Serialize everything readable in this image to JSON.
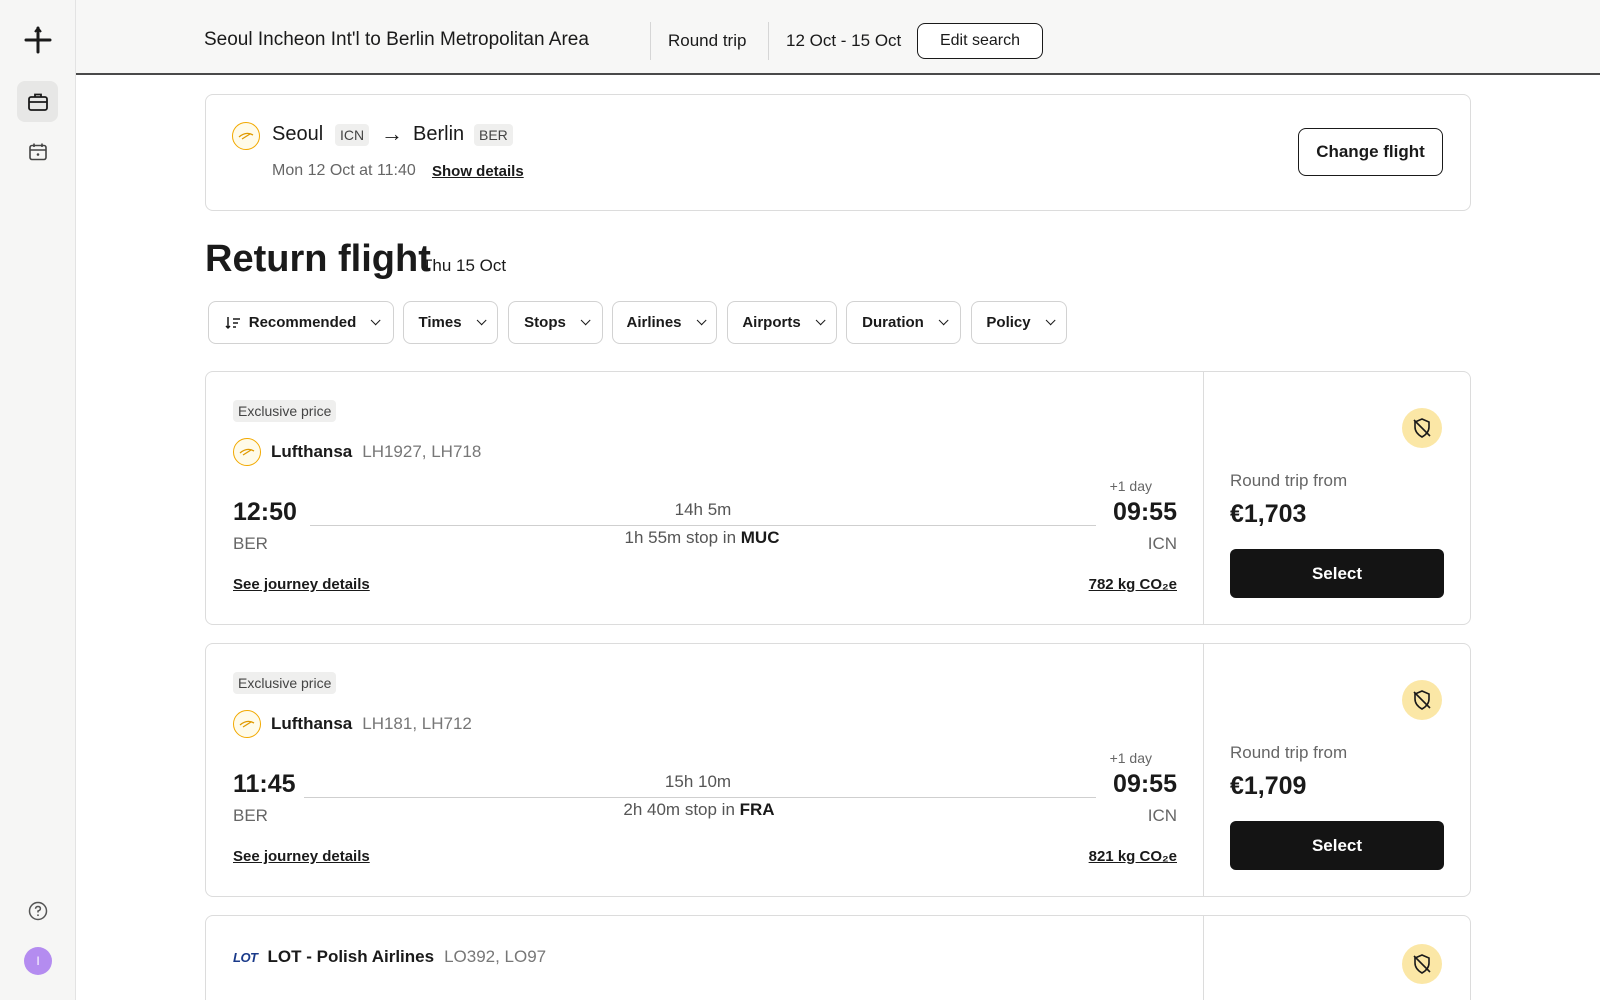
{
  "header": {
    "route": "Seoul Incheon Int'l to Berlin Metropolitan Area",
    "trip_type": "Round trip",
    "dates": "12 Oct - 15 Oct",
    "edit_label": "Edit search"
  },
  "outbound": {
    "from_city": "Seoul",
    "from_code": "ICN",
    "to_city": "Berlin",
    "to_code": "BER",
    "datetime": "Mon 12 Oct at 11:40",
    "show_details": "Show details",
    "change_label": "Change flight"
  },
  "return": {
    "title": "Return flight",
    "date": "Thu 15 Oct"
  },
  "filters": [
    "Recommended",
    "Times",
    "Stops",
    "Airlines",
    "Airports",
    "Duration",
    "Policy"
  ],
  "flights": [
    {
      "badge": "Exclusive price",
      "airline": "Lufthansa",
      "numbers": "LH1927, LH718",
      "dep_time": "12:50",
      "arr_time": "09:55",
      "plus_day": "+1 day",
      "duration": "14h 5m",
      "stop_text": "1h 55m stop in",
      "stop_airport": "MUC",
      "dep_airport": "BER",
      "arr_airport": "ICN",
      "journey_link": "See journey details",
      "co2": "782 kg CO₂e",
      "price_label": "Round trip from",
      "price": "€1,703",
      "select_label": "Select"
    },
    {
      "badge": "Exclusive price",
      "airline": "Lufthansa",
      "numbers": "LH181, LH712",
      "dep_time": "11:45",
      "arr_time": "09:55",
      "plus_day": "+1 day",
      "duration": "15h 10m",
      "stop_text": "2h 40m stop in",
      "stop_airport": "FRA",
      "dep_airport": "BER",
      "arr_airport": "ICN",
      "journey_link": "See journey details",
      "co2": "821 kg CO₂e",
      "price_label": "Round trip from",
      "price": "€1,709",
      "select_label": "Select"
    },
    {
      "airline": "LOT - Polish Airlines",
      "numbers": "LO392, LO97",
      "logo_text": "LOT"
    }
  ],
  "sidebar": {
    "avatar_initial": "I"
  },
  "icons": {
    "brand": "plus-logo-icon",
    "trips": "briefcase-icon",
    "calendar": "calendar-icon",
    "help": "help-circle-icon",
    "policy": "shield-off-icon",
    "sort": "sort-icon",
    "arrow": "arrow-right-icon"
  },
  "colors": {
    "select_button": "#141414",
    "policy_badge": "#fbe7a6",
    "lufthansa_accent": "#f2a900",
    "avatar": "#b48cf0"
  }
}
